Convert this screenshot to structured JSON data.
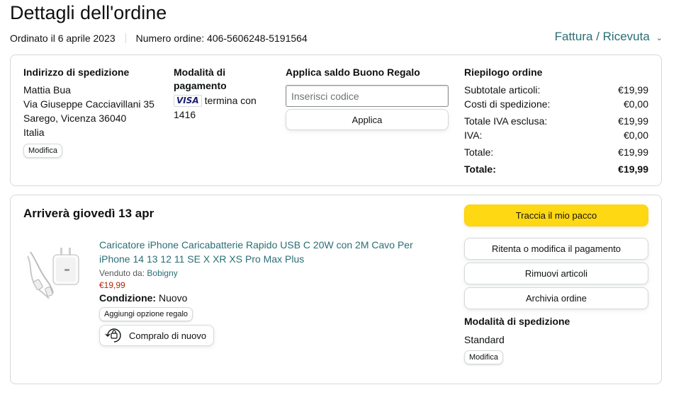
{
  "header": {
    "title": "Dettagli dell'ordine",
    "ordered_on": "Ordinato il 6 aprile 2023",
    "order_number": "Numero ordine: 406-5606248-5191564",
    "invoice_link": "Fattura / Ricevuta"
  },
  "shipping_address": {
    "heading": "Indirizzo di spedizione",
    "lines": [
      "Mattia Bua",
      "Via Giuseppe Cacciavillani 35",
      "Sarego, Vicenza 36040",
      "Italia"
    ],
    "edit_label": "Modifica"
  },
  "payment": {
    "heading_line1": "Modalità di",
    "heading_line2": "pagamento",
    "card_brand": "VISA",
    "ending_text": "termina con",
    "last_digits": "1416"
  },
  "gift_card": {
    "heading": "Applica saldo Buono Regalo",
    "placeholder": "Inserisci codice",
    "apply_label": "Applica"
  },
  "summary": {
    "heading": "Riepilogo ordine",
    "rows": [
      {
        "label": "Subtotale articoli:",
        "value": "€19,99"
      },
      {
        "label": "Costi di spedizione:",
        "value": "€0,00"
      },
      {
        "label": "Totale IVA esclusa:",
        "value": "€19,99"
      },
      {
        "label": "IVA:",
        "value": "€0,00"
      },
      {
        "label": "Totale:",
        "value": "€19,99"
      },
      {
        "label": "Totale:",
        "value": "€19,99"
      }
    ]
  },
  "shipment": {
    "arrival": "Arriverà giovedì 13 apr",
    "product": {
      "title": "Caricatore iPhone Caricabatterie Rapido USB C 20W con 2M Cavo Per iPhone 14 13 12 11 SE X XR XS Pro Max Plus",
      "sold_by_label": "Venduto da:",
      "seller": "Bobigny",
      "price": "€19,99",
      "condition_label": "Condizione:",
      "condition_value": "Nuovo",
      "gift_option_label": "Aggiungi opzione regalo",
      "buy_again_label": "Compralo di nuovo"
    },
    "actions": {
      "track": "Traccia il mio pacco",
      "retry_payment": "Ritenta o modifica il pagamento",
      "remove_items": "Rimuovi articoli",
      "archive": "Archivia ordine"
    },
    "shipping_method": {
      "heading": "Modalità di spedizione",
      "value": "Standard",
      "edit_label": "Modifica"
    }
  },
  "colors": {
    "link": "#2a6e75",
    "price": "#b12704",
    "track_button": "#ffd814",
    "border": "#d5d9d9"
  }
}
